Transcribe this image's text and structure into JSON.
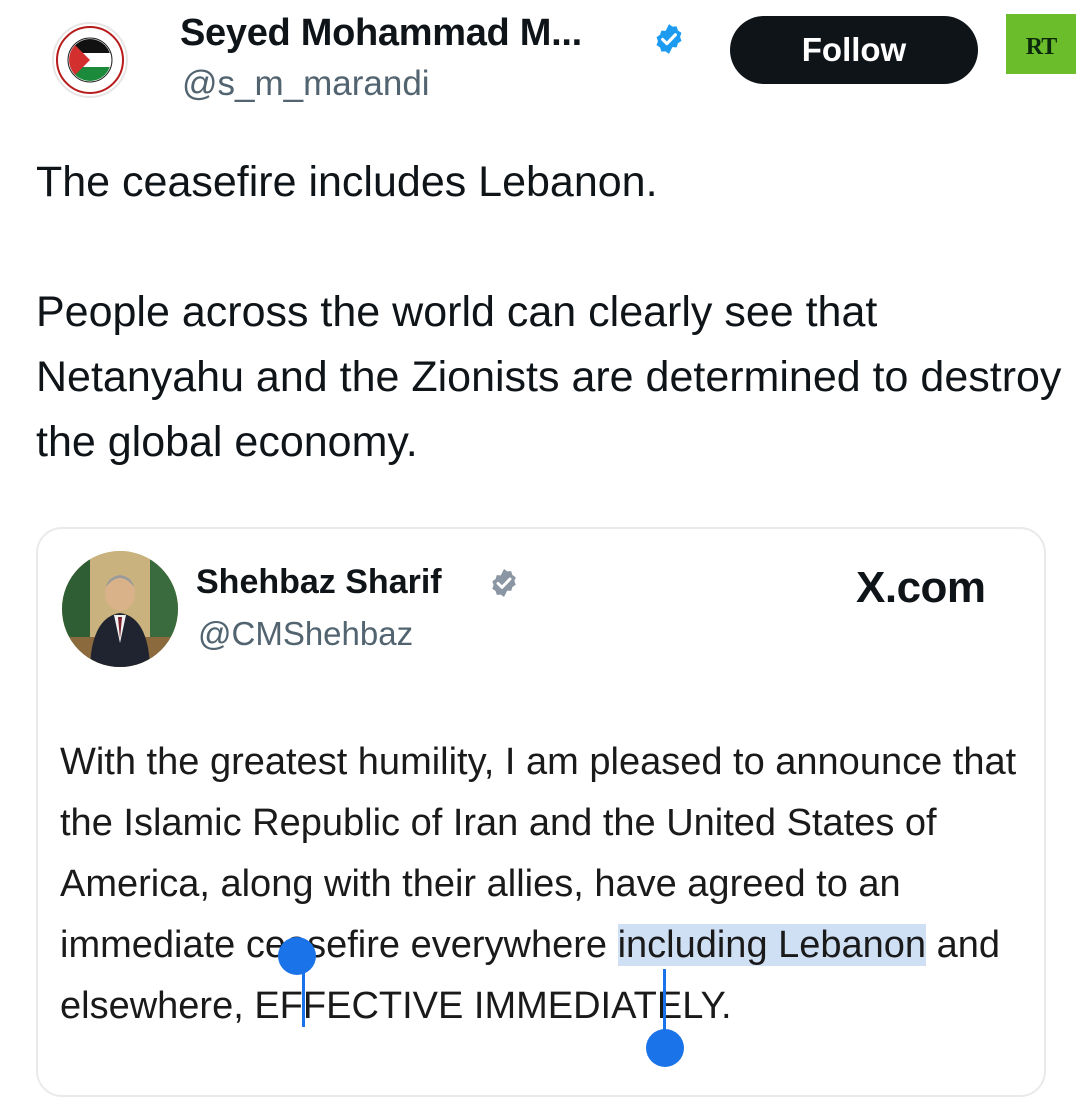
{
  "author": {
    "name": "Seyed Mohammad M...",
    "handle": "@s_m_marandi",
    "verified_icon": "verified-badge-icon"
  },
  "follow_button": {
    "label": "Follow"
  },
  "watermark": {
    "label": "RT"
  },
  "tweet": {
    "paragraphs": [
      "The ceasefire includes Lebanon.",
      "People across the world can clearly see that Netanyahu and the Zionists are determined to destroy the global economy."
    ]
  },
  "quote": {
    "name": "Shehbaz Sharif",
    "handle": "@CMShehbaz",
    "source": "X.com",
    "text_before": "With the greatest humility, I am pleased to announce that the Islamic Republic of Iran and the United States of America, along with their allies, have agreed to an immediate ceasefire everywhere ",
    "text_selected": "including Lebanon",
    "text_after": " and elsewhere, EFFECTIVE IMMEDIATELY."
  },
  "colors": {
    "follow_bg": "#0f1419",
    "verified": "#1d9bf0",
    "rt_badge": "#6bbd2c",
    "selection": "#cfe0f5",
    "selection_handle": "#1a73e8"
  }
}
